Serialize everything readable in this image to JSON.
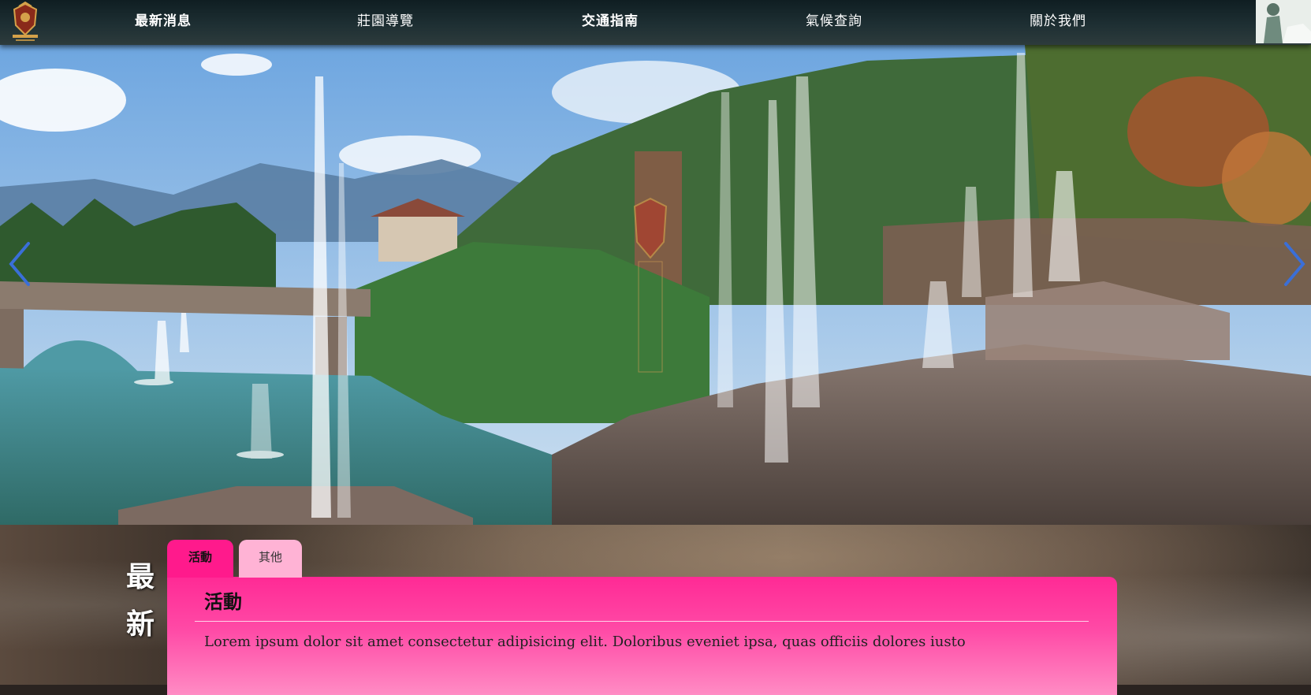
{
  "nav": {
    "logo_alt": "薰衣草森林莊園",
    "items": [
      {
        "label": "最新消息"
      },
      {
        "label": "莊園導覽"
      },
      {
        "label": "交通指南"
      },
      {
        "label": "氣候查詢"
      },
      {
        "label": "關於我們"
      }
    ]
  },
  "hero": {
    "prev_icon": "chevron-left-icon",
    "next_icon": "chevron-right-icon",
    "accent_color": "#3a6fd8"
  },
  "news": {
    "heading_line1": "最",
    "heading_line2": "新",
    "tabs": [
      {
        "label": "活動"
      },
      {
        "label": "其他"
      }
    ],
    "panel_title": "活動",
    "panel_text": "Lorem ipsum dolor sit amet consectetur adipisicing elit. Doloribus eveniet ipsa, quas officiis dolores iusto",
    "accent_pink": "#ff1a8c",
    "tab_inactive_pink": "#ffb3d5"
  }
}
